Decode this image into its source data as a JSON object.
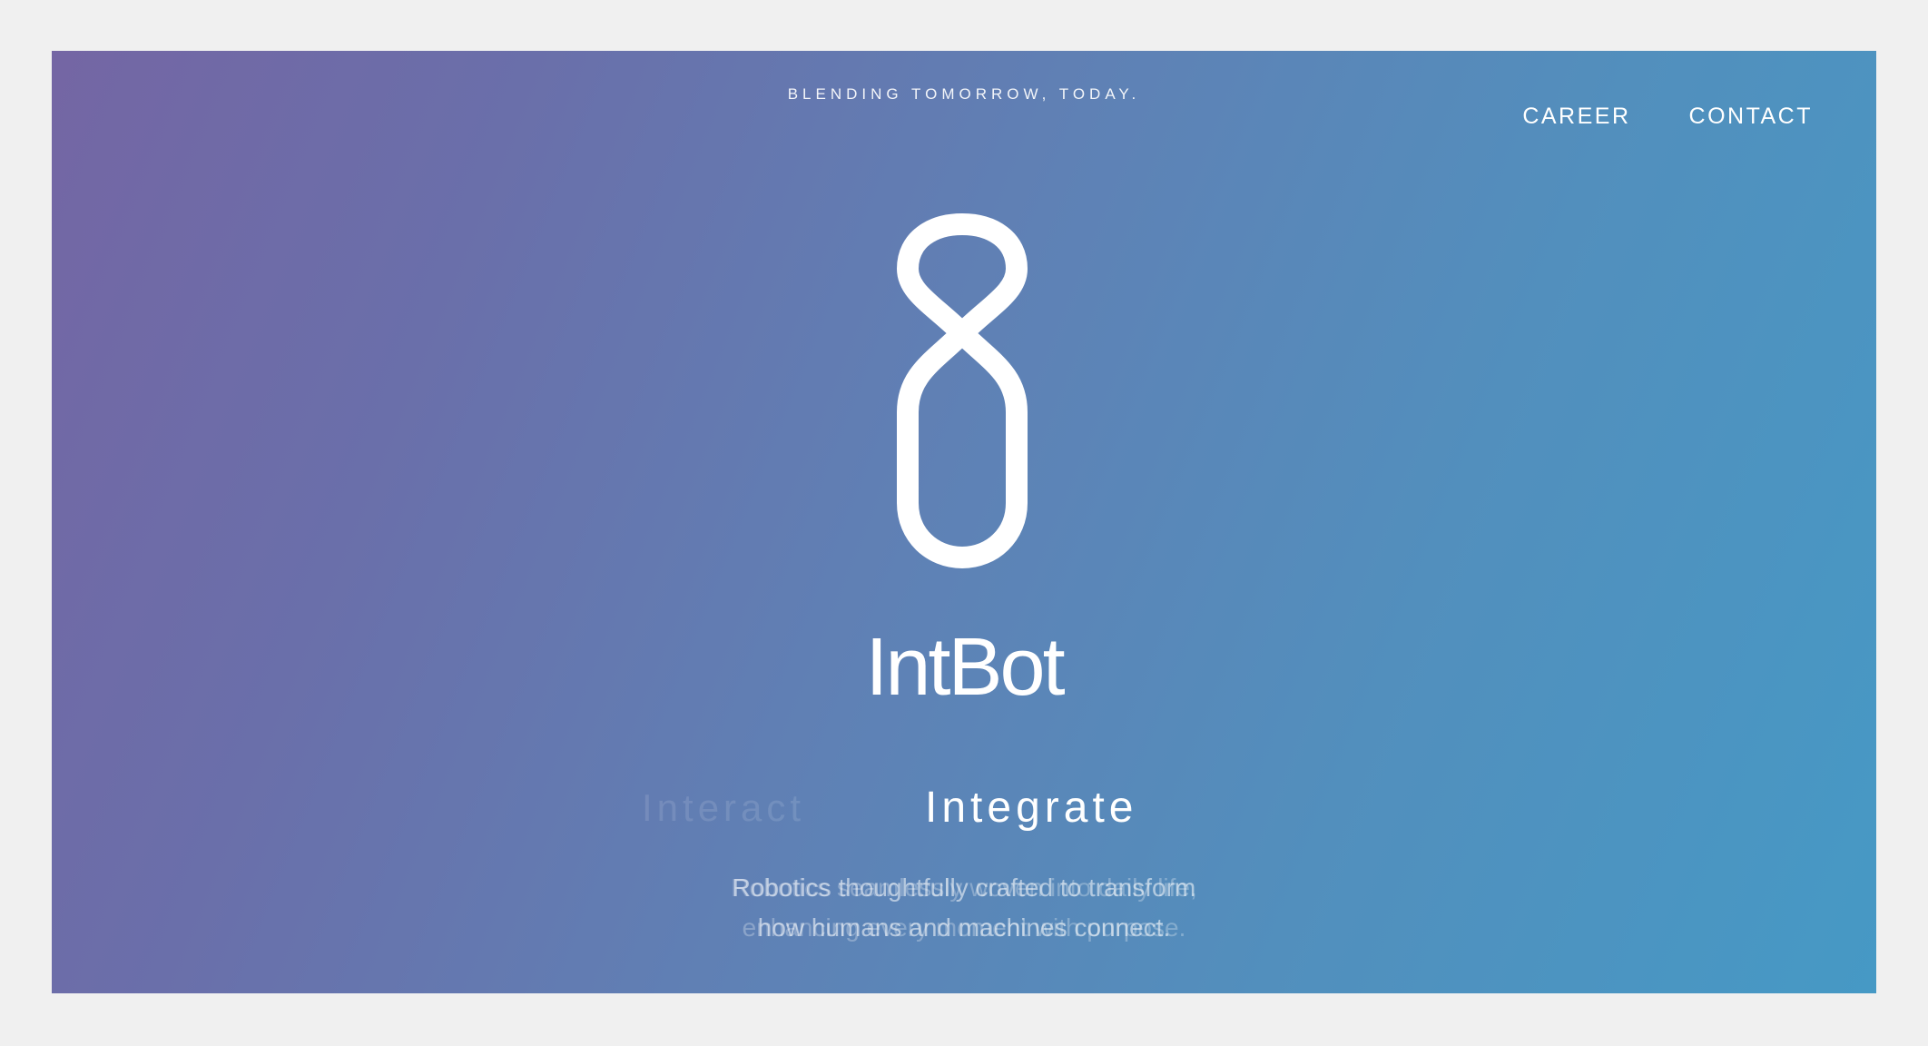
{
  "header": {
    "tagline": "BLENDING TOMORROW, TODAY."
  },
  "nav": {
    "items": [
      {
        "label": "CAREER"
      },
      {
        "label": "CONTACT"
      }
    ]
  },
  "brand": {
    "name": "IntBot",
    "logo_icon": "figure-eight-logo-icon"
  },
  "carousel": {
    "faded_word": "Interact",
    "active_word": "Integrate",
    "faded_description": {
      "line1": "Robotics seamlessly woven into daily life,",
      "line2": "enhancing every moment with purpose."
    },
    "active_description": {
      "line1": "Robotics thoughtfully crafted to transform",
      "line2": "how humans and machines connect."
    }
  },
  "colors": {
    "gradient_start": "#7466a4",
    "gradient_end": "#4699c5",
    "page_background": "#f0f0f0",
    "text": "#ffffff"
  }
}
